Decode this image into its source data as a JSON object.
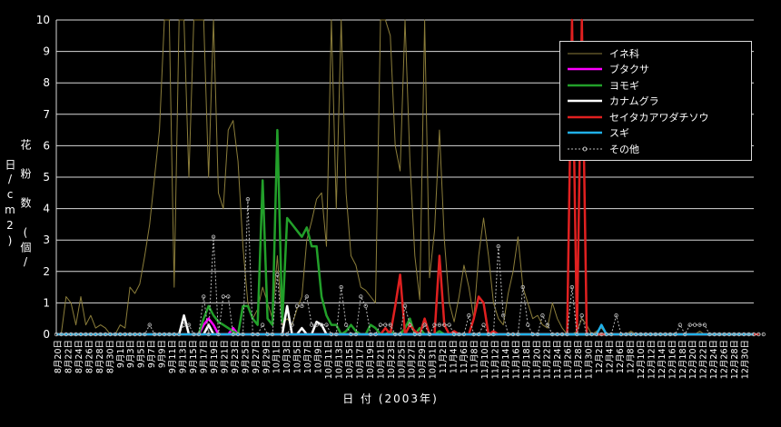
{
  "chart_data": {
    "type": "line",
    "ylabel": "花 粉 数 (個/日/cm2)",
    "xlabel": "日 付 (2003年)",
    "ylim": [
      0,
      10
    ],
    "yticks": [
      0,
      1,
      2,
      3,
      4,
      5,
      6,
      7,
      8,
      9,
      10
    ],
    "grid": "horizontal",
    "legend_position": "top-right",
    "categories": [
      "8月20日",
      "8月22日",
      "8月24日",
      "8月26日",
      "8月28日",
      "8月30日",
      "9月1日",
      "9月3日",
      "9月5日",
      "9月7日",
      "9月9日",
      "9月11日",
      "9月13日",
      "9月15日",
      "9月17日",
      "9月19日",
      "9月21日",
      "9月23日",
      "9月25日",
      "9月27日",
      "9月29日",
      "10月1日",
      "10月3日",
      "10月5日",
      "10月7日",
      "10月9日",
      "10月11日",
      "10月13日",
      "10月15日",
      "10月17日",
      "10月19日",
      "10月21日",
      "10月23日",
      "10月25日",
      "10月27日",
      "10月29日",
      "10月31日",
      "11月2日",
      "11月4日",
      "11月6日",
      "11月8日",
      "11月10日",
      "11月12日",
      "11月14日",
      "11月16日",
      "11月18日",
      "11月20日",
      "11月22日",
      "11月24日",
      "11月26日",
      "11月28日",
      "11月30日",
      "12月2日",
      "12月4日",
      "12月6日",
      "12月8日",
      "12月10日",
      "12月12日",
      "12月14日",
      "12月16日",
      "12月18日",
      "12月20日",
      "12月22日",
      "12月24日",
      "12月26日",
      "12月28日",
      "12月30日"
    ],
    "series": [
      {
        "name": "イネ科",
        "color": "#8b7d3a",
        "style": "thin",
        "values": [
          0,
          0,
          1.2,
          1,
          0.3,
          1.2,
          0.3,
          0.6,
          0.2,
          0.3,
          0.2,
          0,
          0,
          0.3,
          0.2,
          1.5,
          1.3,
          1.6,
          2.5,
          3.5,
          5,
          6.5,
          10,
          10,
          1.5,
          10,
          10,
          5,
          10,
          10,
          10,
          5,
          10,
          4.5,
          4,
          6.5,
          6.8,
          5.5,
          2.8,
          1,
          0.5,
          0.8,
          1.5,
          1,
          0.5,
          2.5,
          0.3,
          0.5,
          0.3,
          0.8,
          1.2,
          3,
          3.6,
          4.3,
          4.5,
          2.8,
          10,
          4,
          10,
          4.5,
          2.5,
          2.2,
          1.5,
          1.4,
          1.2,
          1,
          10,
          10,
          9.5,
          6,
          5.2,
          10,
          5.5,
          2.5,
          1.1,
          10,
          1.8,
          3.3,
          6.5,
          3,
          1,
          0.4,
          1.2,
          2.2,
          1.5,
          0.5,
          2.5,
          3.7,
          2.5,
          1,
          0.5,
          0.3,
          1.3,
          2,
          3.1,
          1.5,
          1,
          0.5,
          0.6,
          0.3,
          0.2,
          1,
          0.5,
          0.2,
          0,
          0,
          0.1,
          0.5,
          0.3,
          0,
          0.1,
          0.2,
          0,
          0,
          0,
          0,
          0,
          0.1,
          0,
          0,
          0,
          0,
          0,
          0,
          0,
          0,
          0,
          0,
          0,
          0,
          0,
          0.1,
          0,
          0,
          0,
          0,
          0,
          0,
          0,
          0,
          0,
          0,
          0
        ]
      },
      {
        "name": "ブタクサ",
        "color": "#ff00ff",
        "style": "bold",
        "values": [
          0,
          0,
          0,
          0,
          0,
          0,
          0,
          0,
          0,
          0,
          0,
          0,
          0,
          0,
          0,
          0,
          0,
          0,
          0,
          0,
          0,
          0,
          0,
          0,
          0,
          0,
          0,
          0,
          0,
          0,
          0.3,
          0.5,
          0.3,
          0,
          0,
          0,
          0.2,
          0,
          0,
          0,
          0,
          0,
          0,
          0,
          0,
          0,
          0,
          0,
          0,
          0,
          0,
          0,
          0,
          0,
          0,
          0,
          0,
          0,
          0,
          0,
          0,
          0,
          0,
          0,
          0,
          0,
          0,
          0,
          0,
          0,
          0,
          0,
          0,
          0,
          0,
          0,
          0,
          0,
          0,
          0,
          0,
          0,
          0,
          0,
          0,
          0,
          0,
          0,
          0,
          0,
          0,
          0,
          0,
          0,
          0,
          0,
          0,
          0,
          0,
          0,
          0,
          0,
          0,
          0,
          0,
          0,
          0,
          0,
          0,
          0,
          0,
          0,
          0,
          0,
          0,
          0,
          0,
          0,
          0,
          0,
          0,
          0,
          0,
          0,
          0,
          0,
          0,
          0,
          0,
          0,
          0,
          0,
          0,
          0,
          0,
          0,
          0,
          0,
          0,
          0,
          0,
          0
        ]
      },
      {
        "name": "ヨモギ",
        "color": "#22a02a",
        "style": "bold",
        "values": [
          0,
          0,
          0,
          0,
          0,
          0,
          0,
          0,
          0,
          0,
          0,
          0,
          0,
          0,
          0,
          0,
          0,
          0,
          0,
          0,
          0,
          0,
          0,
          0,
          0,
          0,
          0,
          0,
          0,
          0,
          0.5,
          0.9,
          0.6,
          0.4,
          0.3,
          0.2,
          0.1,
          0,
          0.9,
          0.9,
          0.5,
          0.3,
          4.9,
          0.5,
          0.3,
          6.5,
          0.4,
          3.7,
          3.5,
          3.3,
          3.1,
          3.4,
          2.8,
          2.8,
          1.2,
          0.6,
          0.3,
          0.3,
          0,
          0.1,
          0.3,
          0.1,
          0,
          0,
          0.3,
          0.2,
          0,
          0,
          0.1,
          0,
          0,
          0.2,
          0.5,
          0,
          0.2,
          0,
          0,
          0,
          0.1,
          0,
          0,
          0,
          0,
          0,
          0,
          0,
          0,
          0,
          0,
          0,
          0,
          0,
          0,
          0,
          0,
          0,
          0,
          0,
          0,
          0,
          0,
          0,
          0,
          0,
          0,
          0,
          0,
          0,
          0,
          0,
          0,
          0,
          0,
          0,
          0,
          0,
          0,
          0,
          0,
          0,
          0,
          0,
          0,
          0,
          0,
          0,
          0,
          0,
          0,
          0,
          0,
          0,
          0,
          0,
          0,
          0,
          0,
          0,
          0,
          0,
          0,
          0,
          0
        ]
      },
      {
        "name": "カナムグラ",
        "color": "#ffffff",
        "style": "bold",
        "values": [
          0,
          0,
          0,
          0,
          0,
          0,
          0,
          0,
          0,
          0,
          0,
          0,
          0,
          0,
          0,
          0,
          0,
          0,
          0,
          0,
          0,
          0,
          0,
          0,
          0,
          0,
          0.6,
          0,
          0,
          0,
          0,
          0.3,
          0,
          0,
          0,
          0,
          0,
          0,
          0,
          0,
          0,
          0,
          0,
          0,
          0,
          0,
          0,
          0.9,
          0,
          0,
          0.2,
          0,
          0,
          0.4,
          0.3,
          0,
          0,
          0,
          0,
          0,
          0,
          0,
          0,
          0,
          0,
          0,
          0,
          0,
          0,
          0,
          0,
          0,
          0,
          0,
          0,
          0,
          0,
          0,
          0,
          0,
          0,
          0,
          0,
          0,
          0,
          0,
          0,
          0,
          0,
          0,
          0,
          0,
          0,
          0,
          0,
          0,
          0,
          0,
          0,
          0,
          0,
          0,
          0,
          0,
          0,
          0,
          0,
          0,
          0,
          0,
          0,
          0,
          0,
          0,
          0,
          0,
          0,
          0,
          0,
          0,
          0,
          0,
          0,
          0,
          0,
          0,
          0,
          0,
          0,
          0,
          0,
          0,
          0,
          0,
          0,
          0,
          0,
          0,
          0,
          0,
          0,
          0,
          0
        ]
      },
      {
        "name": "セイタカアワダチソウ",
        "color": "#e02020",
        "style": "bold",
        "values": [
          0,
          0,
          0,
          0,
          0,
          0,
          0,
          0,
          0,
          0,
          0,
          0,
          0,
          0,
          0,
          0,
          0,
          0,
          0,
          0,
          0,
          0,
          0,
          0,
          0,
          0,
          0,
          0,
          0,
          0,
          0,
          0,
          0,
          0,
          0,
          0,
          0,
          0,
          0,
          0,
          0,
          0,
          0,
          0,
          0,
          0,
          0,
          0,
          0,
          0,
          0,
          0,
          0,
          0,
          0,
          0,
          0,
          0,
          0,
          0,
          0,
          0,
          0,
          0,
          0,
          0,
          0,
          0.2,
          0,
          0.9,
          1.9,
          0,
          0.3,
          0.1,
          0,
          0.5,
          0,
          0,
          2.5,
          0.3,
          0,
          0.1,
          0,
          0,
          0,
          0.5,
          1.2,
          1,
          0,
          0.1,
          0,
          0,
          0,
          0,
          0,
          0,
          0,
          0,
          0,
          0,
          0,
          0,
          0,
          0,
          0,
          10,
          0,
          10,
          0,
          0,
          0,
          0,
          0,
          0,
          0,
          0,
          0,
          0,
          0,
          0,
          0,
          0,
          0,
          0,
          0,
          0,
          0,
          0,
          0,
          0,
          0,
          0,
          0,
          0,
          0,
          0,
          0,
          0,
          0,
          0,
          0,
          0,
          0,
          0
        ]
      },
      {
        "name": "スギ",
        "color": "#20b0e8",
        "style": "bold",
        "values": [
          0,
          0,
          0,
          0,
          0,
          0,
          0,
          0,
          0,
          0,
          0,
          0,
          0,
          0,
          0,
          0,
          0,
          0,
          0,
          0,
          0,
          0,
          0,
          0,
          0,
          0,
          0,
          0,
          0,
          0,
          0,
          0,
          0,
          0,
          0,
          0,
          0,
          0,
          0,
          0,
          0,
          0,
          0,
          0,
          0,
          0,
          0,
          0,
          0,
          0,
          0,
          0,
          0,
          0,
          0,
          0,
          0,
          0,
          0,
          0,
          0,
          0,
          0,
          0,
          0,
          0,
          0,
          0,
          0,
          0,
          0,
          0,
          0,
          0,
          0,
          0,
          0,
          0,
          0,
          0,
          0,
          0,
          0,
          0,
          0,
          0,
          0,
          0,
          0,
          0,
          0,
          0,
          0,
          0,
          0,
          0,
          0,
          0,
          0,
          0,
          0,
          0,
          0,
          0,
          0,
          0,
          0,
          0,
          0,
          0,
          0,
          0.3,
          0,
          0,
          0,
          0,
          0,
          0,
          0,
          0,
          0,
          0,
          0,
          0,
          0,
          0,
          0,
          0,
          0,
          0,
          0,
          0,
          0,
          0,
          0,
          0,
          0,
          0,
          0,
          0,
          0,
          0,
          0
        ]
      },
      {
        "name": "その他",
        "color": "#bbbbbb",
        "style": "dotted",
        "values": [
          0,
          0,
          0,
          0,
          0,
          0,
          0,
          0,
          0,
          0,
          0,
          0,
          0,
          0,
          0,
          0,
          0,
          0,
          0,
          0.3,
          0,
          0,
          0,
          0,
          0,
          0,
          0.3,
          0.3,
          0,
          0,
          1.2,
          0,
          3.1,
          0,
          1.2,
          1.2,
          0,
          0,
          0,
          4.3,
          0,
          0,
          0.3,
          0,
          0,
          1.9,
          0,
          0,
          0.3,
          0.9,
          0.9,
          1.2,
          0.3,
          0.3,
          0.3,
          0.3,
          0,
          0,
          1.5,
          0.3,
          0,
          0,
          1.2,
          0.9,
          0,
          0,
          0.3,
          0.3,
          0.3,
          0,
          0,
          0.9,
          0.3,
          0,
          0,
          0.3,
          0,
          0.3,
          0.3,
          0.3,
          0.3,
          0,
          0,
          0,
          0.6,
          0,
          0,
          0.3,
          0,
          0,
          2.8,
          0.6,
          0,
          0,
          0,
          1.5,
          0.3,
          0,
          0,
          0.6,
          0.3,
          0,
          0,
          0,
          0,
          1.5,
          0,
          0.6,
          0,
          0,
          0,
          0,
          0,
          0,
          0.6,
          0,
          0,
          0,
          0,
          0,
          0,
          0,
          0,
          0,
          0,
          0,
          0,
          0.3,
          0,
          0.3,
          0.3,
          0.3,
          0.3,
          0,
          0,
          0,
          0,
          0,
          0,
          0,
          0,
          0,
          0,
          0,
          0
        ]
      }
    ]
  }
}
